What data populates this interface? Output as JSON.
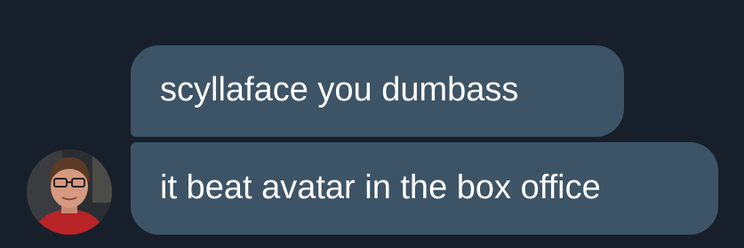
{
  "conversation": {
    "messages": [
      {
        "text": "scyllaface you dumbass"
      },
      {
        "text": "it beat avatar in the box office"
      }
    ],
    "sender": {
      "avatar_icon": "user-avatar"
    }
  },
  "colors": {
    "background": "#17202a",
    "bubble": "#3d5466",
    "text": "#ffffff"
  }
}
